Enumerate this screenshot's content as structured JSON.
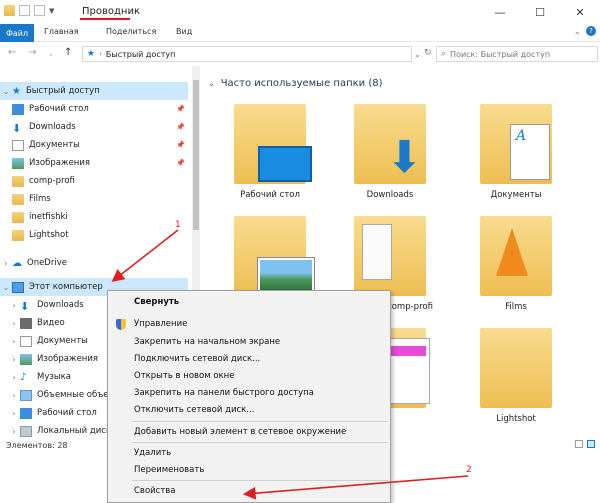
{
  "window": {
    "title": "Проводник",
    "controls": {
      "minimize": "—",
      "maximize": "☐",
      "close": "✕"
    }
  },
  "ribbon": {
    "tabs": [
      "Файл",
      "Главная",
      "Поделиться",
      "Вид"
    ]
  },
  "address": {
    "path": "Быстрый доступ",
    "search_placeholder": "Поиск: Быстрый доступ"
  },
  "nav": {
    "quick_access": "Быстрый доступ",
    "quick_items": [
      "Рабочий стол",
      "Downloads",
      "Документы",
      "Изображения",
      "comp-profi",
      "Films",
      "inetfishki",
      "Lightshot"
    ],
    "onedrive": "OneDrive",
    "this_pc": "Этот компьютер",
    "pc_items": [
      "Downloads",
      "Видео",
      "Документы",
      "Изображения",
      "Музыка",
      "Объемные объекты",
      "Рабочий стол",
      "Локальный диск"
    ]
  },
  "status": {
    "items_count": "Элементов: 28"
  },
  "content": {
    "section_title": "Часто используемые папки (8)",
    "tiles": [
      "Рабочий стол",
      "Downloads",
      "Документы",
      "",
      "comp-profi",
      "Films",
      "",
      "Lightshot"
    ]
  },
  "context_menu": {
    "items": [
      "Свернуть",
      "Управление",
      "Закрепить на начальном экране",
      "Подключить сетевой диск...",
      "Открыть в новом окне",
      "Закрепить на панели быстрого доступа",
      "Отключить сетевой диск...",
      "Добавить новый элемент в сетевое окружение",
      "Удалить",
      "Переименовать",
      "Свойства"
    ]
  },
  "annotations": {
    "marker1": "1",
    "marker2": "2",
    "color": "#e02020"
  },
  "colors": {
    "accent": "#1979ca",
    "selection": "#cce8ff",
    "folder": "#eebd52"
  }
}
